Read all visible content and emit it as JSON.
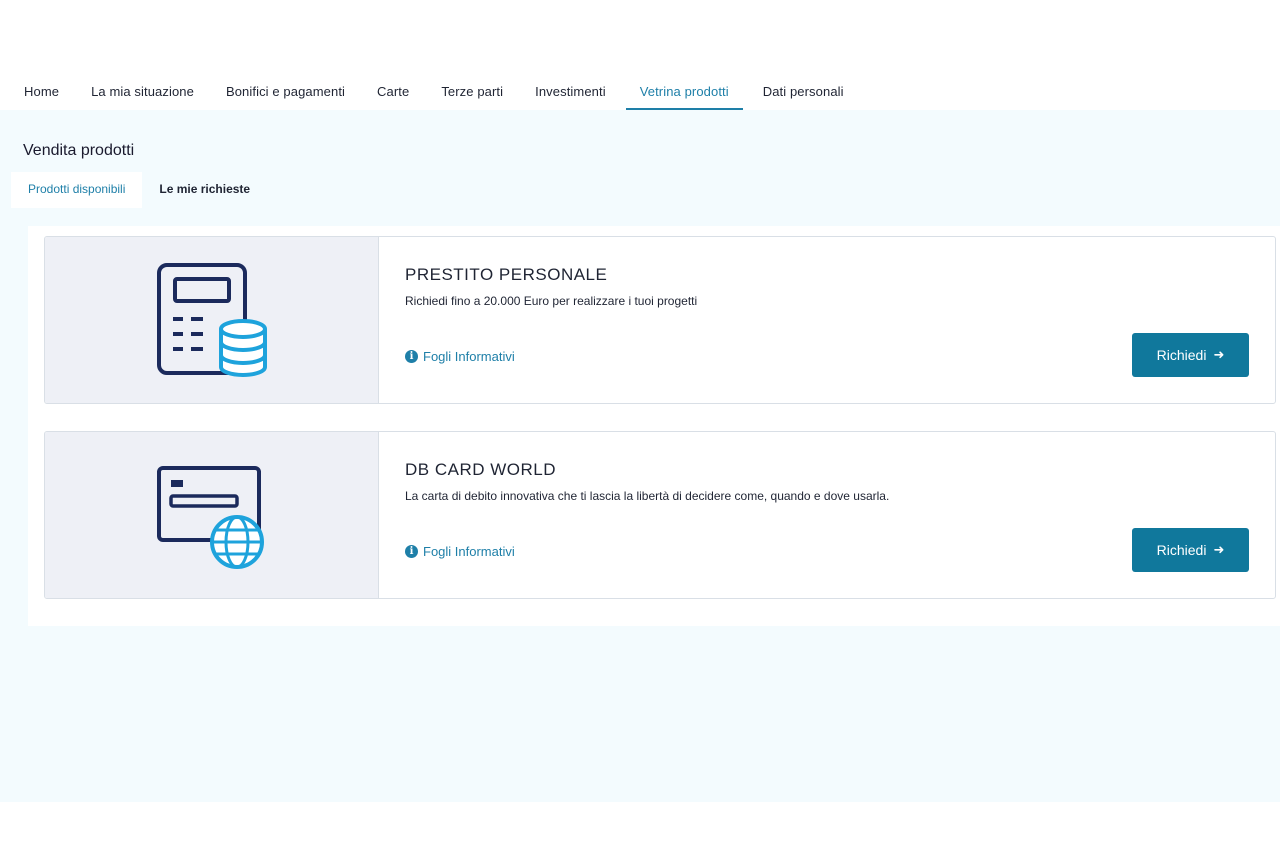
{
  "nav": {
    "items": [
      {
        "label": "Home"
      },
      {
        "label": "La mia situazione"
      },
      {
        "label": "Bonifici e pagamenti"
      },
      {
        "label": "Carte"
      },
      {
        "label": "Terze parti"
      },
      {
        "label": "Investimenti"
      },
      {
        "label": "Vetrina prodotti"
      },
      {
        "label": "Dati personali"
      }
    ],
    "active": "Vetrina prodotti"
  },
  "page": {
    "title": "Vendita prodotti",
    "tabs": [
      {
        "label": "Prodotti disponibili"
      },
      {
        "label": "Le mie richieste"
      }
    ]
  },
  "products": [
    {
      "title": "PRESTITO PERSONALE",
      "description": "Richiedi fino a 20.000 Euro per realizzare i tuoi progetti",
      "link_label": "Fogli Informativi",
      "button_label": "Richiedi",
      "icon": "calculator-coins-icon"
    },
    {
      "title": "DB CARD WORLD",
      "description": "La carta di debito innovativa che ti lascia la libertà di decidere come, quando e dove usarla.",
      "link_label": "Fogli Informativi",
      "button_label": "Richiedi",
      "icon": "card-globe-icon"
    }
  ],
  "colors": {
    "accent": "#1e7fa8",
    "button": "#10789c",
    "icon_dark": "#1b2a5c",
    "icon_light": "#1ea3dc",
    "content_bg": "#f3fbfe"
  }
}
